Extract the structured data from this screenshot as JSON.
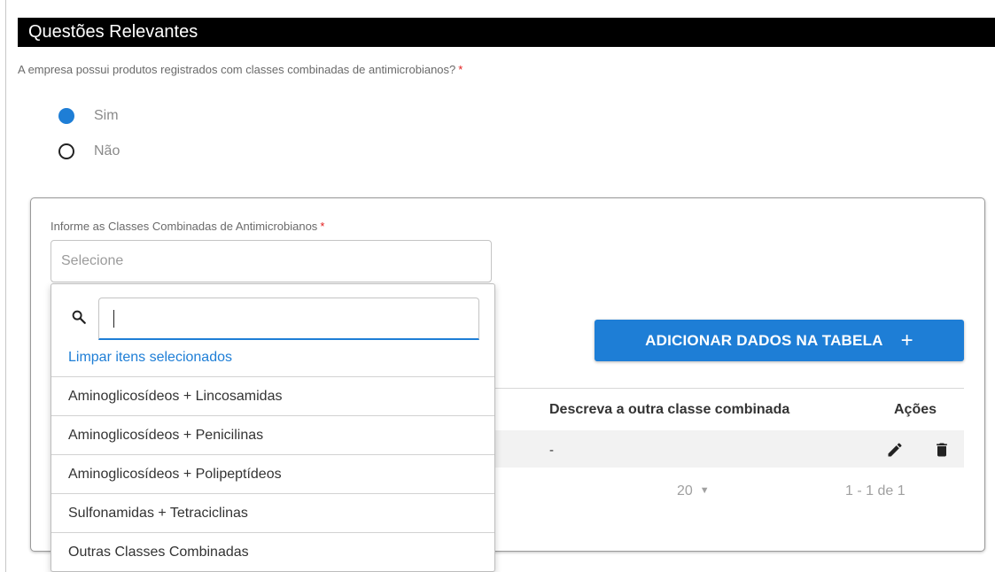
{
  "section": {
    "title": "Questões Relevantes"
  },
  "question": {
    "text": "A empresa possui produtos registrados com classes combinadas de antimicrobianos?",
    "required_mark": "*"
  },
  "radio": {
    "options": [
      {
        "label": "Sim",
        "selected": true
      },
      {
        "label": "Não",
        "selected": false
      }
    ]
  },
  "form": {
    "field_label": "Informe as Classes Combinadas de Antimicrobianos",
    "required_mark": "*",
    "select_placeholder": "Selecione",
    "add_button_label": "ADICIONAR DADOS NA TABELA",
    "add_button_icon": "+"
  },
  "table": {
    "headers": {
      "descricao": "Descreva a outra classe combinada",
      "acoes": "Ações"
    },
    "rows": [
      {
        "descricao": "-",
        "actions": [
          "pencil-icon",
          "trash-icon"
        ]
      }
    ],
    "page_size": "20",
    "range": "1 - 1 de 1"
  },
  "dropdown": {
    "search_value": "",
    "clear_label": "Limpar itens selecionados",
    "items": [
      "Aminoglicosídeos + Lincosamidas",
      "Aminoglicosídeos + Penicilinas",
      "Aminoglicosídeos + Polipeptídeos",
      "Sulfonamidas + Tetraciclinas",
      "Outras Classes Combinadas"
    ]
  },
  "colors": {
    "accent": "#1e7ed6",
    "required": "#e21d1d",
    "header_bg": "#000000"
  }
}
